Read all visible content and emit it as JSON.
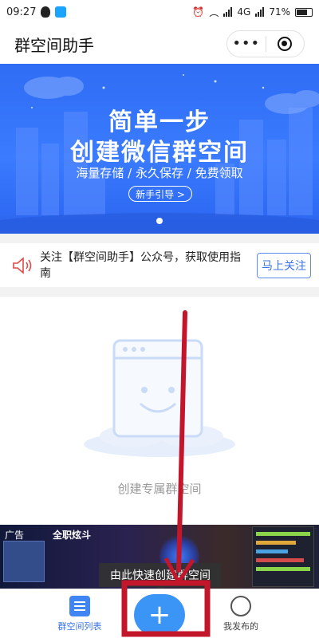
{
  "status_bar": {
    "time": "09:27",
    "battery": "71%",
    "network": "4G"
  },
  "header": {
    "title": "群空间助手",
    "menu_icon": "more-dots-icon",
    "close_icon": "target-close-icon"
  },
  "banner": {
    "line1": "简单一步",
    "line2": "创建微信群空间",
    "line3": "海量存储 / 永久保存 / 免费领取",
    "button_label": "新手引导 >"
  },
  "notice": {
    "text": "关注【群空间助手】公众号，获取使用指南",
    "button_label": "马上关注"
  },
  "empty_state": {
    "label": "创建专属群空间"
  },
  "ad": {
    "tag": "广告",
    "title": "全职炫斗"
  },
  "tooltip": {
    "text": "由此快速创建群空间"
  },
  "tabbar": {
    "items": [
      {
        "label": "群空间列表",
        "icon": "list-icon"
      },
      {
        "label": "我发布的",
        "icon": "user-icon"
      }
    ],
    "center_button": "+"
  },
  "colors": {
    "accent": "#3b95f7",
    "annotation": "#c3162b",
    "banner": "#3a7bff"
  }
}
